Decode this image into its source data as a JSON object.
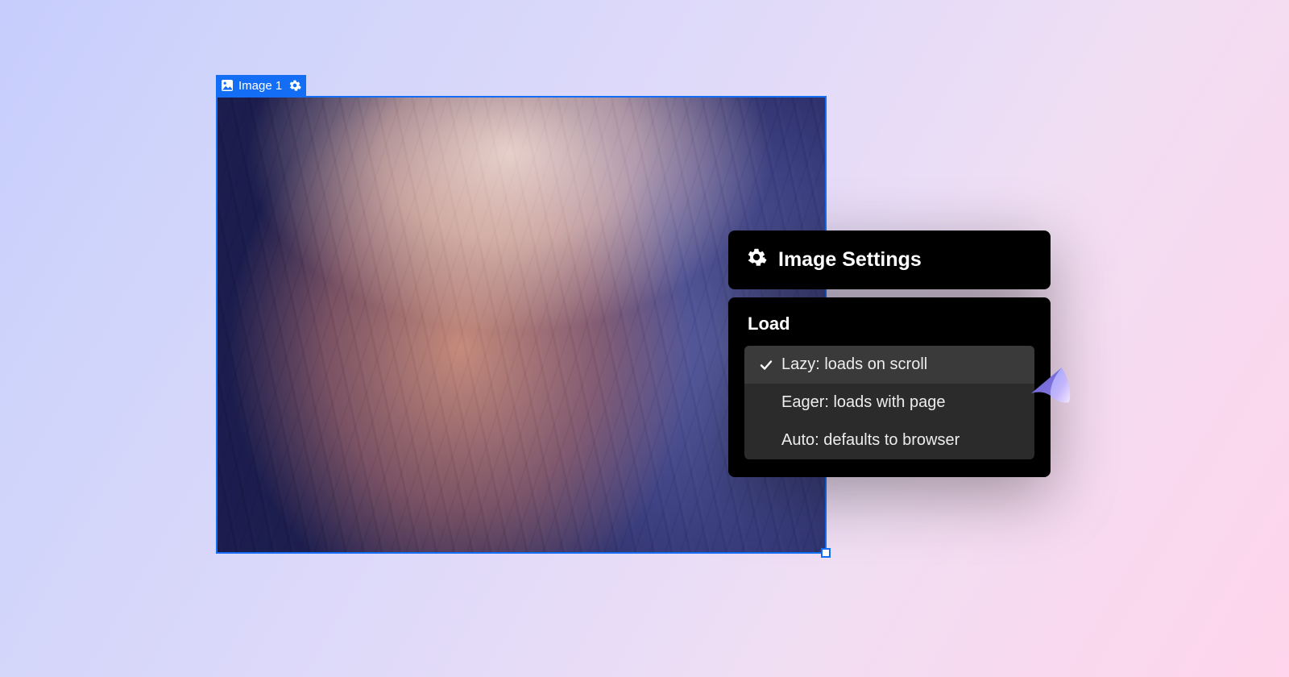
{
  "colors": {
    "selection": "#146ef5",
    "panel_bg": "#000000",
    "option_bg": "#2b2b2b",
    "option_selected_bg": "#3a3a3a"
  },
  "element": {
    "label": "Image 1"
  },
  "settings": {
    "title": "Image Settings",
    "section_label": "Load",
    "options": [
      {
        "label": "Lazy: loads on scroll",
        "selected": true
      },
      {
        "label": "Eager: loads with page",
        "selected": false
      },
      {
        "label": "Auto: defaults to browser",
        "selected": false
      }
    ]
  }
}
